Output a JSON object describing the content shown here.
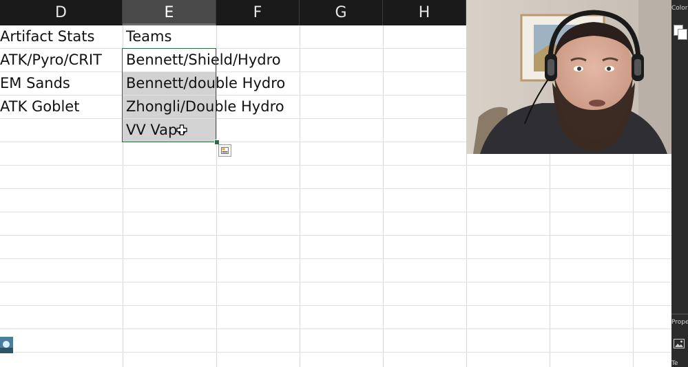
{
  "columns": [
    {
      "letter": "D",
      "selected": false
    },
    {
      "letter": "E",
      "selected": true
    },
    {
      "letter": "F",
      "selected": false
    },
    {
      "letter": "G",
      "selected": false
    },
    {
      "letter": "H",
      "selected": false
    }
  ],
  "cells": {
    "d1": "Artifact Stats",
    "d2": "ATK/Pyro/CRIT",
    "d3": "EM Sands",
    "d4": "ATK Goblet",
    "e1": "Teams",
    "e2": "Bennett/Shield/Hydro",
    "e3": "Bennett/double Hydro",
    "e4": "Zhongli/Double Hydro",
    "e5": "VV Vapo"
  },
  "side_panel": {
    "color_label": "Color",
    "properties_label": "Prope",
    "bottom_label": "Te"
  },
  "icons": {
    "cursor": "plus-cursor-icon",
    "quick_analysis": "quick-analysis-icon",
    "image": "image-icon"
  },
  "colors": {
    "selection_border": "#2e6b3f",
    "selected_fill": "#d2d2d2",
    "header_bg": "#1a1a1a"
  }
}
